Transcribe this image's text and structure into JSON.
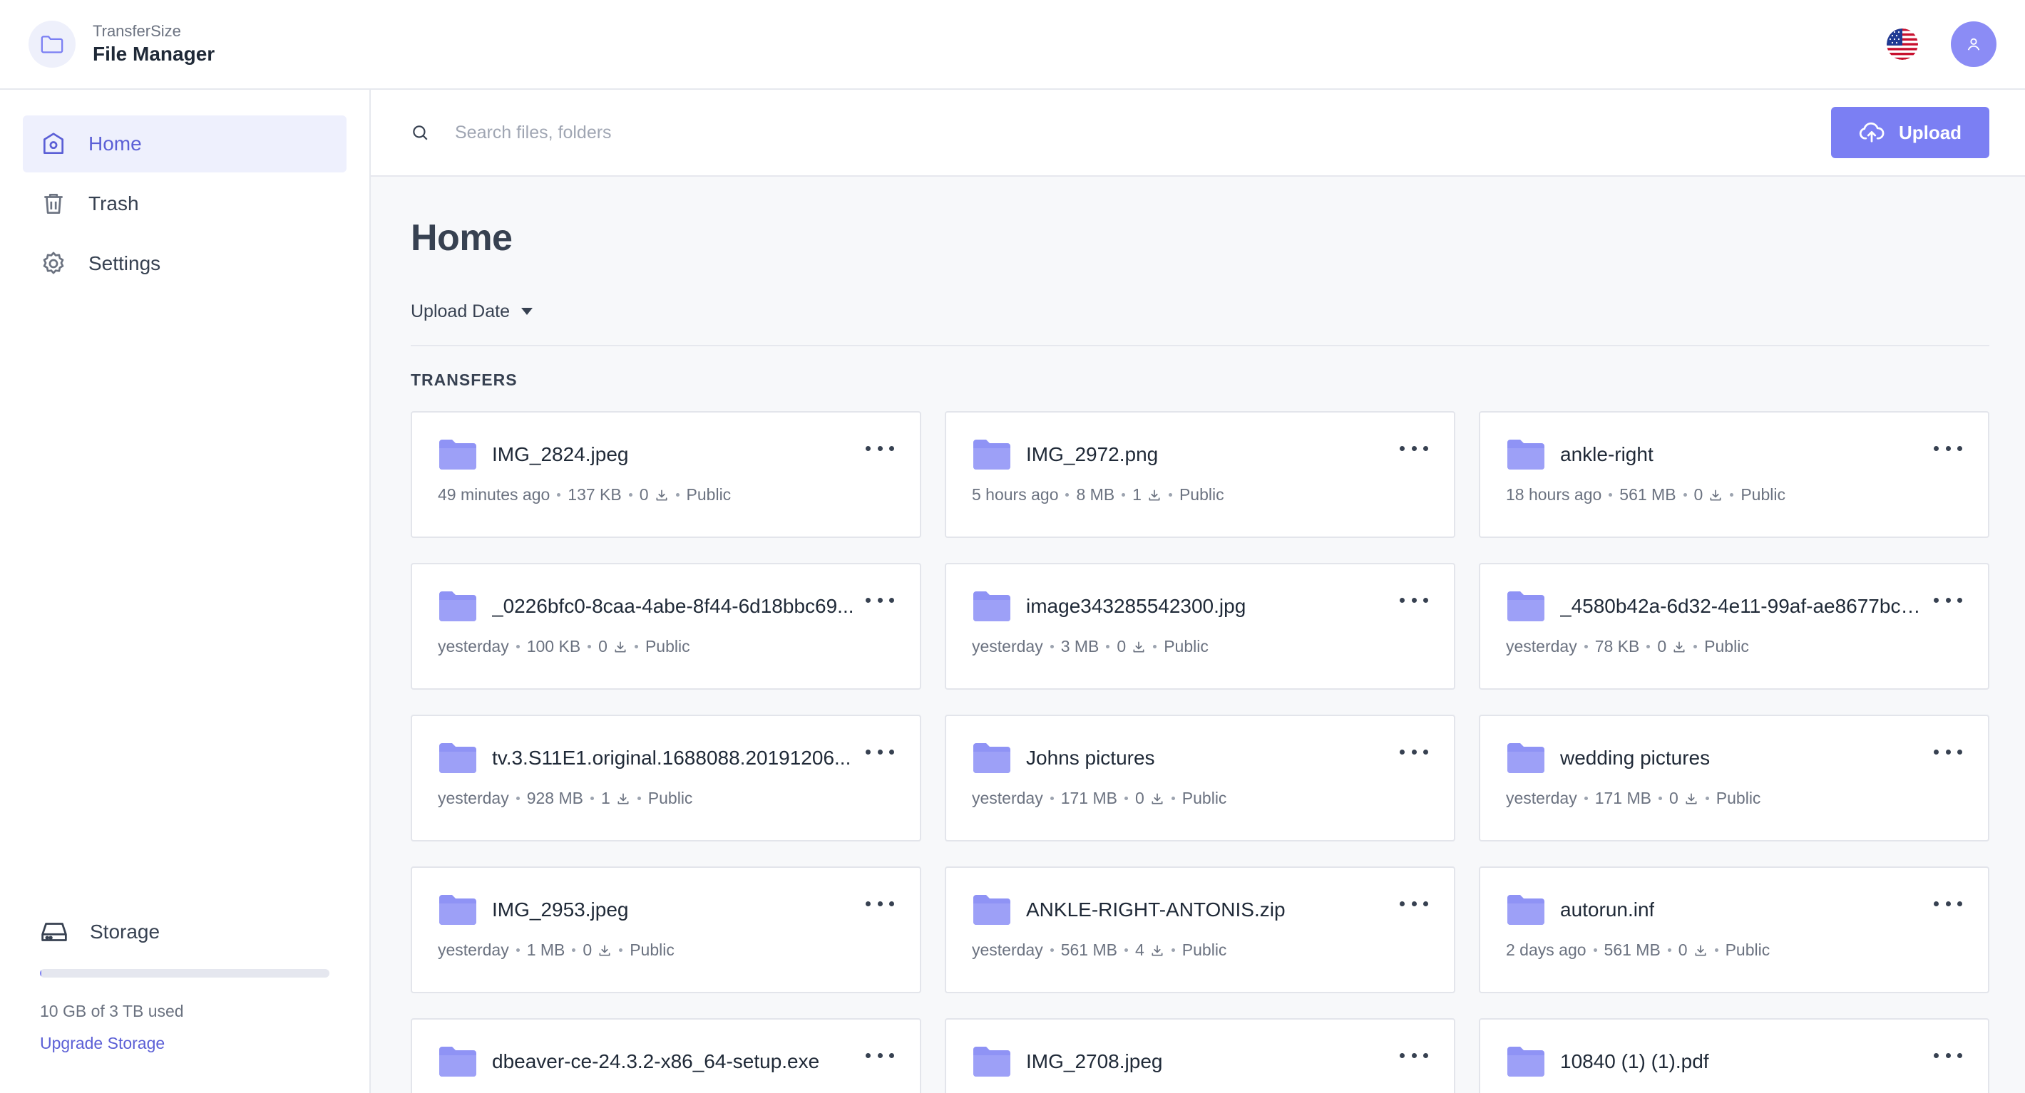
{
  "brand": {
    "subtitle": "TransferSize",
    "title": "File Manager"
  },
  "colors": {
    "accent": "#7b7ff3",
    "folder": "#8f93f5",
    "active_bg": "#eef0fd"
  },
  "sidebar": {
    "items": [
      {
        "label": "Home",
        "icon": "home-icon",
        "active": true
      },
      {
        "label": "Trash",
        "icon": "trash-icon",
        "active": false
      },
      {
        "label": "Settings",
        "icon": "gear-icon",
        "active": false
      }
    ],
    "storage": {
      "label": "Storage",
      "used_text": "10 GB of 3 TB used",
      "used_fraction": 0.0033,
      "upgrade_label": "Upgrade Storage"
    }
  },
  "search": {
    "placeholder": "Search files, folders"
  },
  "upload": {
    "label": "Upload"
  },
  "page": {
    "title": "Home",
    "sort_label": "Upload Date",
    "section": "TRANSFERS"
  },
  "transfers": [
    {
      "name": "IMG_2824.jpeg",
      "time": "49 minutes ago",
      "size": "137 KB",
      "downloads": "0",
      "visibility": "Public"
    },
    {
      "name": "IMG_2972.png",
      "time": "5 hours ago",
      "size": "8 MB",
      "downloads": "1",
      "visibility": "Public"
    },
    {
      "name": "ankle-right",
      "time": "18 hours ago",
      "size": "561 MB",
      "downloads": "0",
      "visibility": "Public"
    },
    {
      "name": "_0226bfc0-8caa-4abe-8f44-6d18bbc69...",
      "time": "yesterday",
      "size": "100 KB",
      "downloads": "0",
      "visibility": "Public"
    },
    {
      "name": "image343285542300.jpg",
      "time": "yesterday",
      "size": "3 MB",
      "downloads": "0",
      "visibility": "Public"
    },
    {
      "name": "_4580b42a-6d32-4e11-99af-ae8677bcb...",
      "time": "yesterday",
      "size": "78 KB",
      "downloads": "0",
      "visibility": "Public"
    },
    {
      "name": "tv.3.S11E1.original.1688088.20191206...",
      "time": "yesterday",
      "size": "928 MB",
      "downloads": "1",
      "visibility": "Public"
    },
    {
      "name": "Johns pictures",
      "time": "yesterday",
      "size": "171 MB",
      "downloads": "0",
      "visibility": "Public"
    },
    {
      "name": "wedding pictures",
      "time": "yesterday",
      "size": "171 MB",
      "downloads": "0",
      "visibility": "Public"
    },
    {
      "name": "IMG_2953.jpeg",
      "time": "yesterday",
      "size": "1 MB",
      "downloads": "0",
      "visibility": "Public"
    },
    {
      "name": "ANKLE-RIGHT-ANTONIS.zip",
      "time": "yesterday",
      "size": "561 MB",
      "downloads": "4",
      "visibility": "Public"
    },
    {
      "name": "autorun.inf",
      "time": "2 days ago",
      "size": "561 MB",
      "downloads": "0",
      "visibility": "Public"
    },
    {
      "name": "dbeaver-ce-24.3.2-x86_64-setup.exe",
      "time": "",
      "size": "",
      "downloads": "",
      "visibility": ""
    },
    {
      "name": "IMG_2708.jpeg",
      "time": "",
      "size": "",
      "downloads": "",
      "visibility": ""
    },
    {
      "name": "10840 (1) (1).pdf",
      "time": "",
      "size": "",
      "downloads": "",
      "visibility": ""
    }
  ]
}
